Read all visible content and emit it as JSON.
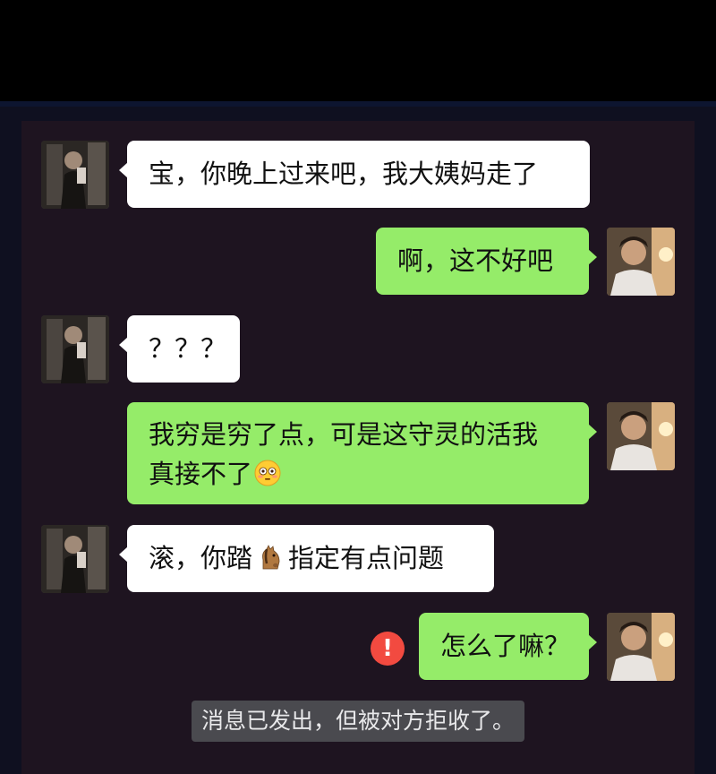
{
  "messages": [
    {
      "text": "宝，你晚上过来吧，我大姨妈走了"
    },
    {
      "text": "啊，这不好吧"
    },
    {
      "text": "？？？"
    },
    {
      "line1": "我穷是穷了点，可是这守灵的活我",
      "line2": "真接不了"
    },
    {
      "text_before": "滚，你踏",
      "text_after": "指定有点问题"
    },
    {
      "text": "怎么了嘛？"
    }
  ],
  "error_icon": {
    "symbol": "!",
    "color": "#f24a40"
  },
  "system_note": "消息已发出，但被对方拒收了。",
  "colors": {
    "incoming_bubble": "#ffffff",
    "outgoing_bubble": "#95ec69",
    "chat_background": "#1e1420"
  },
  "emojis": [
    "flushed-face-emoji",
    "horse-face-emoji"
  ]
}
